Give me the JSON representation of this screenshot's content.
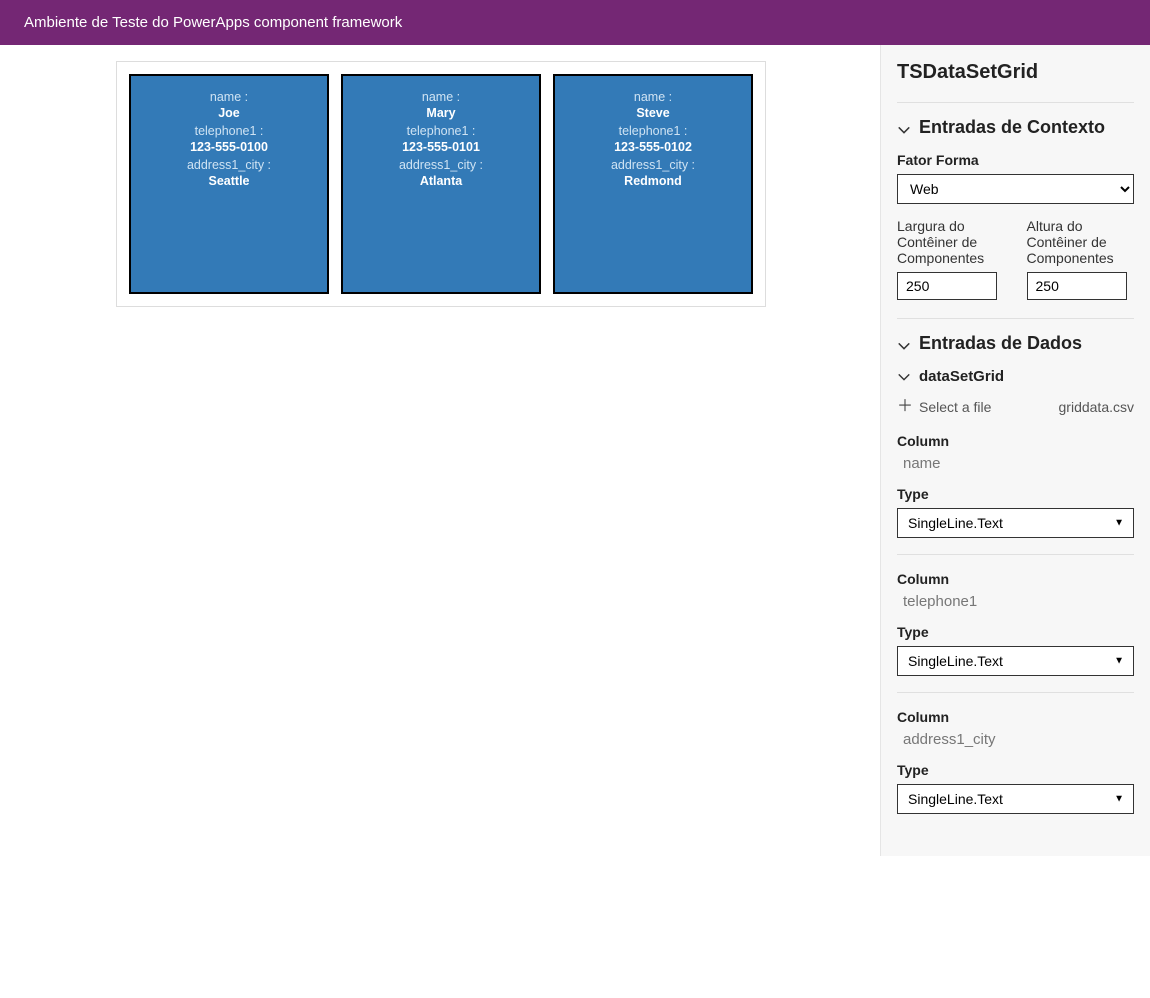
{
  "header": {
    "title": "Ambiente de Teste do PowerApps component framework"
  },
  "component": {
    "name": "TSDataSetGrid"
  },
  "cards": [
    {
      "fields": [
        {
          "label": "name :",
          "value": "Joe"
        },
        {
          "label": "telephone1 :",
          "value": "123-555-0100"
        },
        {
          "label": "address1_city :",
          "value": "Seattle"
        }
      ]
    },
    {
      "fields": [
        {
          "label": "name :",
          "value": "Mary"
        },
        {
          "label": "telephone1 :",
          "value": "123-555-0101"
        },
        {
          "label": "address1_city :",
          "value": "Atlanta"
        }
      ]
    },
    {
      "fields": [
        {
          "label": "name :",
          "value": "Steve"
        },
        {
          "label": "telephone1 :",
          "value": "123-555-0102"
        },
        {
          "label": "address1_city :",
          "value": "Redmond"
        }
      ]
    }
  ],
  "context_inputs": {
    "title": "Entradas de Contexto",
    "form_factor_label": "Fator Forma",
    "form_factor_value": "Web",
    "width_label": "Largura do Contêiner de Componentes",
    "width_value": "250",
    "height_label": "Altura do Contêiner de Componentes",
    "height_value": "250"
  },
  "data_inputs": {
    "title": "Entradas de Dados",
    "dataset_name": "dataSetGrid",
    "select_file_label": "Select a file",
    "filename": "griddata.csv",
    "column_label": "Column",
    "type_label": "Type",
    "type_option": "SingleLine.Text",
    "columns": [
      {
        "name": "name",
        "type": "SingleLine.Text"
      },
      {
        "name": "telephone1",
        "type": "SingleLine.Text"
      },
      {
        "name": "address1_city",
        "type": "SingleLine.Text"
      }
    ]
  }
}
